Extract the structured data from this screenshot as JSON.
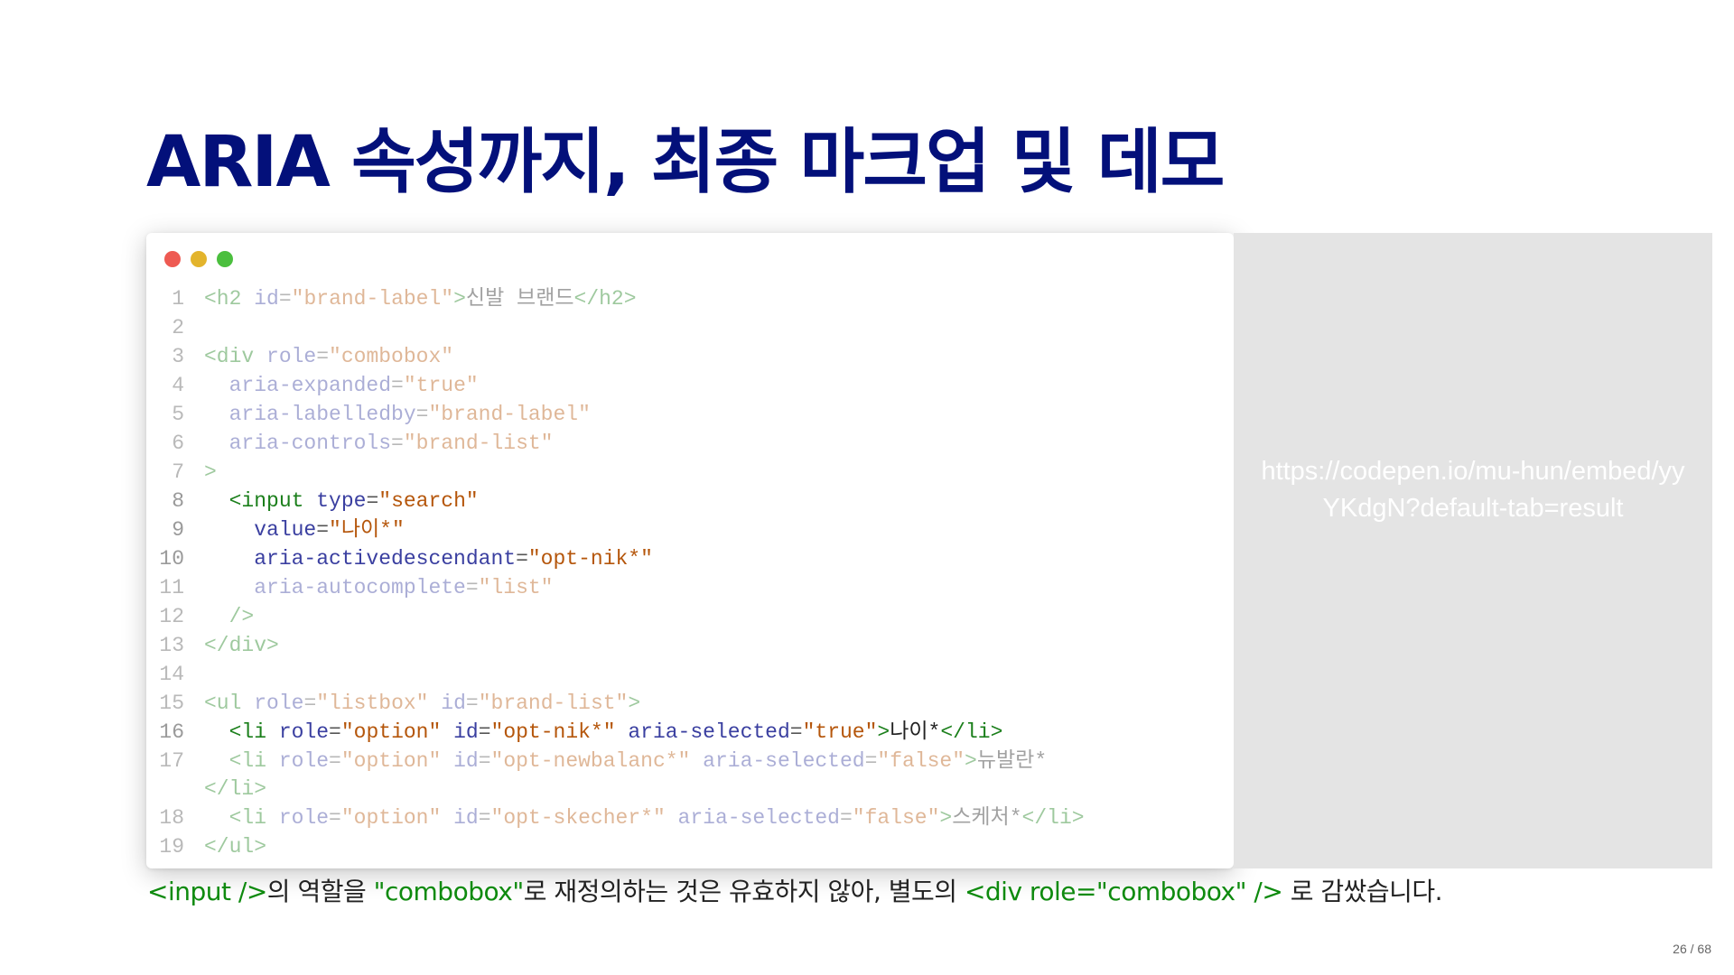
{
  "slide": {
    "title": "ARIA 속성까지, 최종 마크업 및 데모",
    "page_number": "26 / 68"
  },
  "window": {
    "dots": [
      "#ee5a52",
      "#e3b42c",
      "#4bbf3e"
    ]
  },
  "code": {
    "lines": [
      {
        "n": "1",
        "active": false,
        "tokens": [
          {
            "t": "tag",
            "v": "<h2"
          },
          {
            "t": "attr",
            "v": " id"
          },
          {
            "t": "punc",
            "v": "="
          },
          {
            "t": "str",
            "v": "\"brand-label\""
          },
          {
            "t": "tag",
            "v": ">"
          },
          {
            "t": "txt",
            "v": "신발 브랜드"
          },
          {
            "t": "tag",
            "v": "</h2>"
          }
        ]
      },
      {
        "n": "2",
        "active": false,
        "tokens": []
      },
      {
        "n": "3",
        "active": false,
        "tokens": [
          {
            "t": "tag",
            "v": "<div"
          },
          {
            "t": "attr",
            "v": " role"
          },
          {
            "t": "punc",
            "v": "="
          },
          {
            "t": "str",
            "v": "\"combobox\""
          }
        ]
      },
      {
        "n": "4",
        "active": false,
        "tokens": [
          {
            "t": "attr",
            "v": "  aria-expanded"
          },
          {
            "t": "punc",
            "v": "="
          },
          {
            "t": "str",
            "v": "\"true\""
          }
        ]
      },
      {
        "n": "5",
        "active": false,
        "tokens": [
          {
            "t": "attr",
            "v": "  aria-labelledby"
          },
          {
            "t": "punc",
            "v": "="
          },
          {
            "t": "str",
            "v": "\"brand-label\""
          }
        ]
      },
      {
        "n": "6",
        "active": false,
        "tokens": [
          {
            "t": "attr",
            "v": "  aria-controls"
          },
          {
            "t": "punc",
            "v": "="
          },
          {
            "t": "str",
            "v": "\"brand-list\""
          }
        ]
      },
      {
        "n": "7",
        "active": false,
        "tokens": [
          {
            "t": "tag",
            "v": ">"
          }
        ]
      },
      {
        "n": "8",
        "active": true,
        "tokens": [
          {
            "t": "punc",
            "v": "  "
          },
          {
            "t": "tag",
            "v": "<input"
          },
          {
            "t": "attr",
            "v": " type"
          },
          {
            "t": "punc",
            "v": "="
          },
          {
            "t": "str",
            "v": "\"search\""
          }
        ]
      },
      {
        "n": "9",
        "active": true,
        "tokens": [
          {
            "t": "attr",
            "v": "    value"
          },
          {
            "t": "punc",
            "v": "="
          },
          {
            "t": "str",
            "v": "\"나이*\""
          }
        ]
      },
      {
        "n": "10",
        "active": true,
        "tokens": [
          {
            "t": "attr",
            "v": "    aria-activedescendant"
          },
          {
            "t": "punc",
            "v": "="
          },
          {
            "t": "str",
            "v": "\"opt-nik*\""
          }
        ]
      },
      {
        "n": "11",
        "active": false,
        "tokens": [
          {
            "t": "attr",
            "v": "    aria-autocomplete"
          },
          {
            "t": "punc",
            "v": "="
          },
          {
            "t": "str",
            "v": "\"list\""
          }
        ]
      },
      {
        "n": "12",
        "active": false,
        "tokens": [
          {
            "t": "tag",
            "v": "  />"
          }
        ]
      },
      {
        "n": "13",
        "active": false,
        "tokens": [
          {
            "t": "tag",
            "v": "</div>"
          }
        ]
      },
      {
        "n": "14",
        "active": false,
        "tokens": []
      },
      {
        "n": "15",
        "active": false,
        "tokens": [
          {
            "t": "tag",
            "v": "<ul"
          },
          {
            "t": "attr",
            "v": " role"
          },
          {
            "t": "punc",
            "v": "="
          },
          {
            "t": "str",
            "v": "\"listbox\""
          },
          {
            "t": "attr",
            "v": " id"
          },
          {
            "t": "punc",
            "v": "="
          },
          {
            "t": "str",
            "v": "\"brand-list\""
          },
          {
            "t": "tag",
            "v": ">"
          }
        ]
      },
      {
        "n": "16",
        "active": true,
        "tokens": [
          {
            "t": "punc",
            "v": "  "
          },
          {
            "t": "tag",
            "v": "<li"
          },
          {
            "t": "attr",
            "v": " role"
          },
          {
            "t": "punc",
            "v": "="
          },
          {
            "t": "str",
            "v": "\"option\""
          },
          {
            "t": "attr",
            "v": " id"
          },
          {
            "t": "punc",
            "v": "="
          },
          {
            "t": "str",
            "v": "\"opt-nik*\""
          },
          {
            "t": "attr",
            "v": " aria-selected"
          },
          {
            "t": "punc",
            "v": "="
          },
          {
            "t": "str",
            "v": "\"true\""
          },
          {
            "t": "tag",
            "v": ">"
          },
          {
            "t": "txt",
            "v": "나이*"
          },
          {
            "t": "tag",
            "v": "</li>"
          }
        ]
      },
      {
        "n": "17",
        "active": false,
        "tokens": [
          {
            "t": "punc",
            "v": "  "
          },
          {
            "t": "tag",
            "v": "<li"
          },
          {
            "t": "attr",
            "v": " role"
          },
          {
            "t": "punc",
            "v": "="
          },
          {
            "t": "str",
            "v": "\"option\""
          },
          {
            "t": "attr",
            "v": " id"
          },
          {
            "t": "punc",
            "v": "="
          },
          {
            "t": "str",
            "v": "\"opt-newbalanc*\""
          },
          {
            "t": "attr",
            "v": " aria-selected"
          },
          {
            "t": "punc",
            "v": "="
          },
          {
            "t": "str",
            "v": "\"false\""
          },
          {
            "t": "tag",
            "v": ">"
          },
          {
            "t": "txt",
            "v": "뉴발란*"
          }
        ]
      },
      {
        "n": "",
        "active": false,
        "wrap": true,
        "tokens": [
          {
            "t": "tag",
            "v": "</li>"
          }
        ]
      },
      {
        "n": "18",
        "active": false,
        "tokens": [
          {
            "t": "punc",
            "v": "  "
          },
          {
            "t": "tag",
            "v": "<li"
          },
          {
            "t": "attr",
            "v": " role"
          },
          {
            "t": "punc",
            "v": "="
          },
          {
            "t": "str",
            "v": "\"option\""
          },
          {
            "t": "attr",
            "v": " id"
          },
          {
            "t": "punc",
            "v": "="
          },
          {
            "t": "str",
            "v": "\"opt-skecher*\""
          },
          {
            "t": "attr",
            "v": " aria-selected"
          },
          {
            "t": "punc",
            "v": "="
          },
          {
            "t": "str",
            "v": "\"false\""
          },
          {
            "t": "tag",
            "v": ">"
          },
          {
            "t": "txt",
            "v": "스케처*"
          },
          {
            "t": "tag",
            "v": "</li>"
          }
        ]
      },
      {
        "n": "19",
        "active": false,
        "tokens": [
          {
            "t": "tag",
            "v": "</ul>"
          }
        ]
      }
    ]
  },
  "embed": {
    "url": "https://codepen.io/mu-hun/embed/yyYKdgN?default-tab=result"
  },
  "caption": {
    "code1": "<input />",
    "text1": "의 역할을 ",
    "code2": "\"combobox\"",
    "text2": "로 재정의하는 것은 유효하지 않아, 별도의 ",
    "code3": "<div role=\"combobox\" />",
    "text3": " 로 감쌌습니다."
  }
}
